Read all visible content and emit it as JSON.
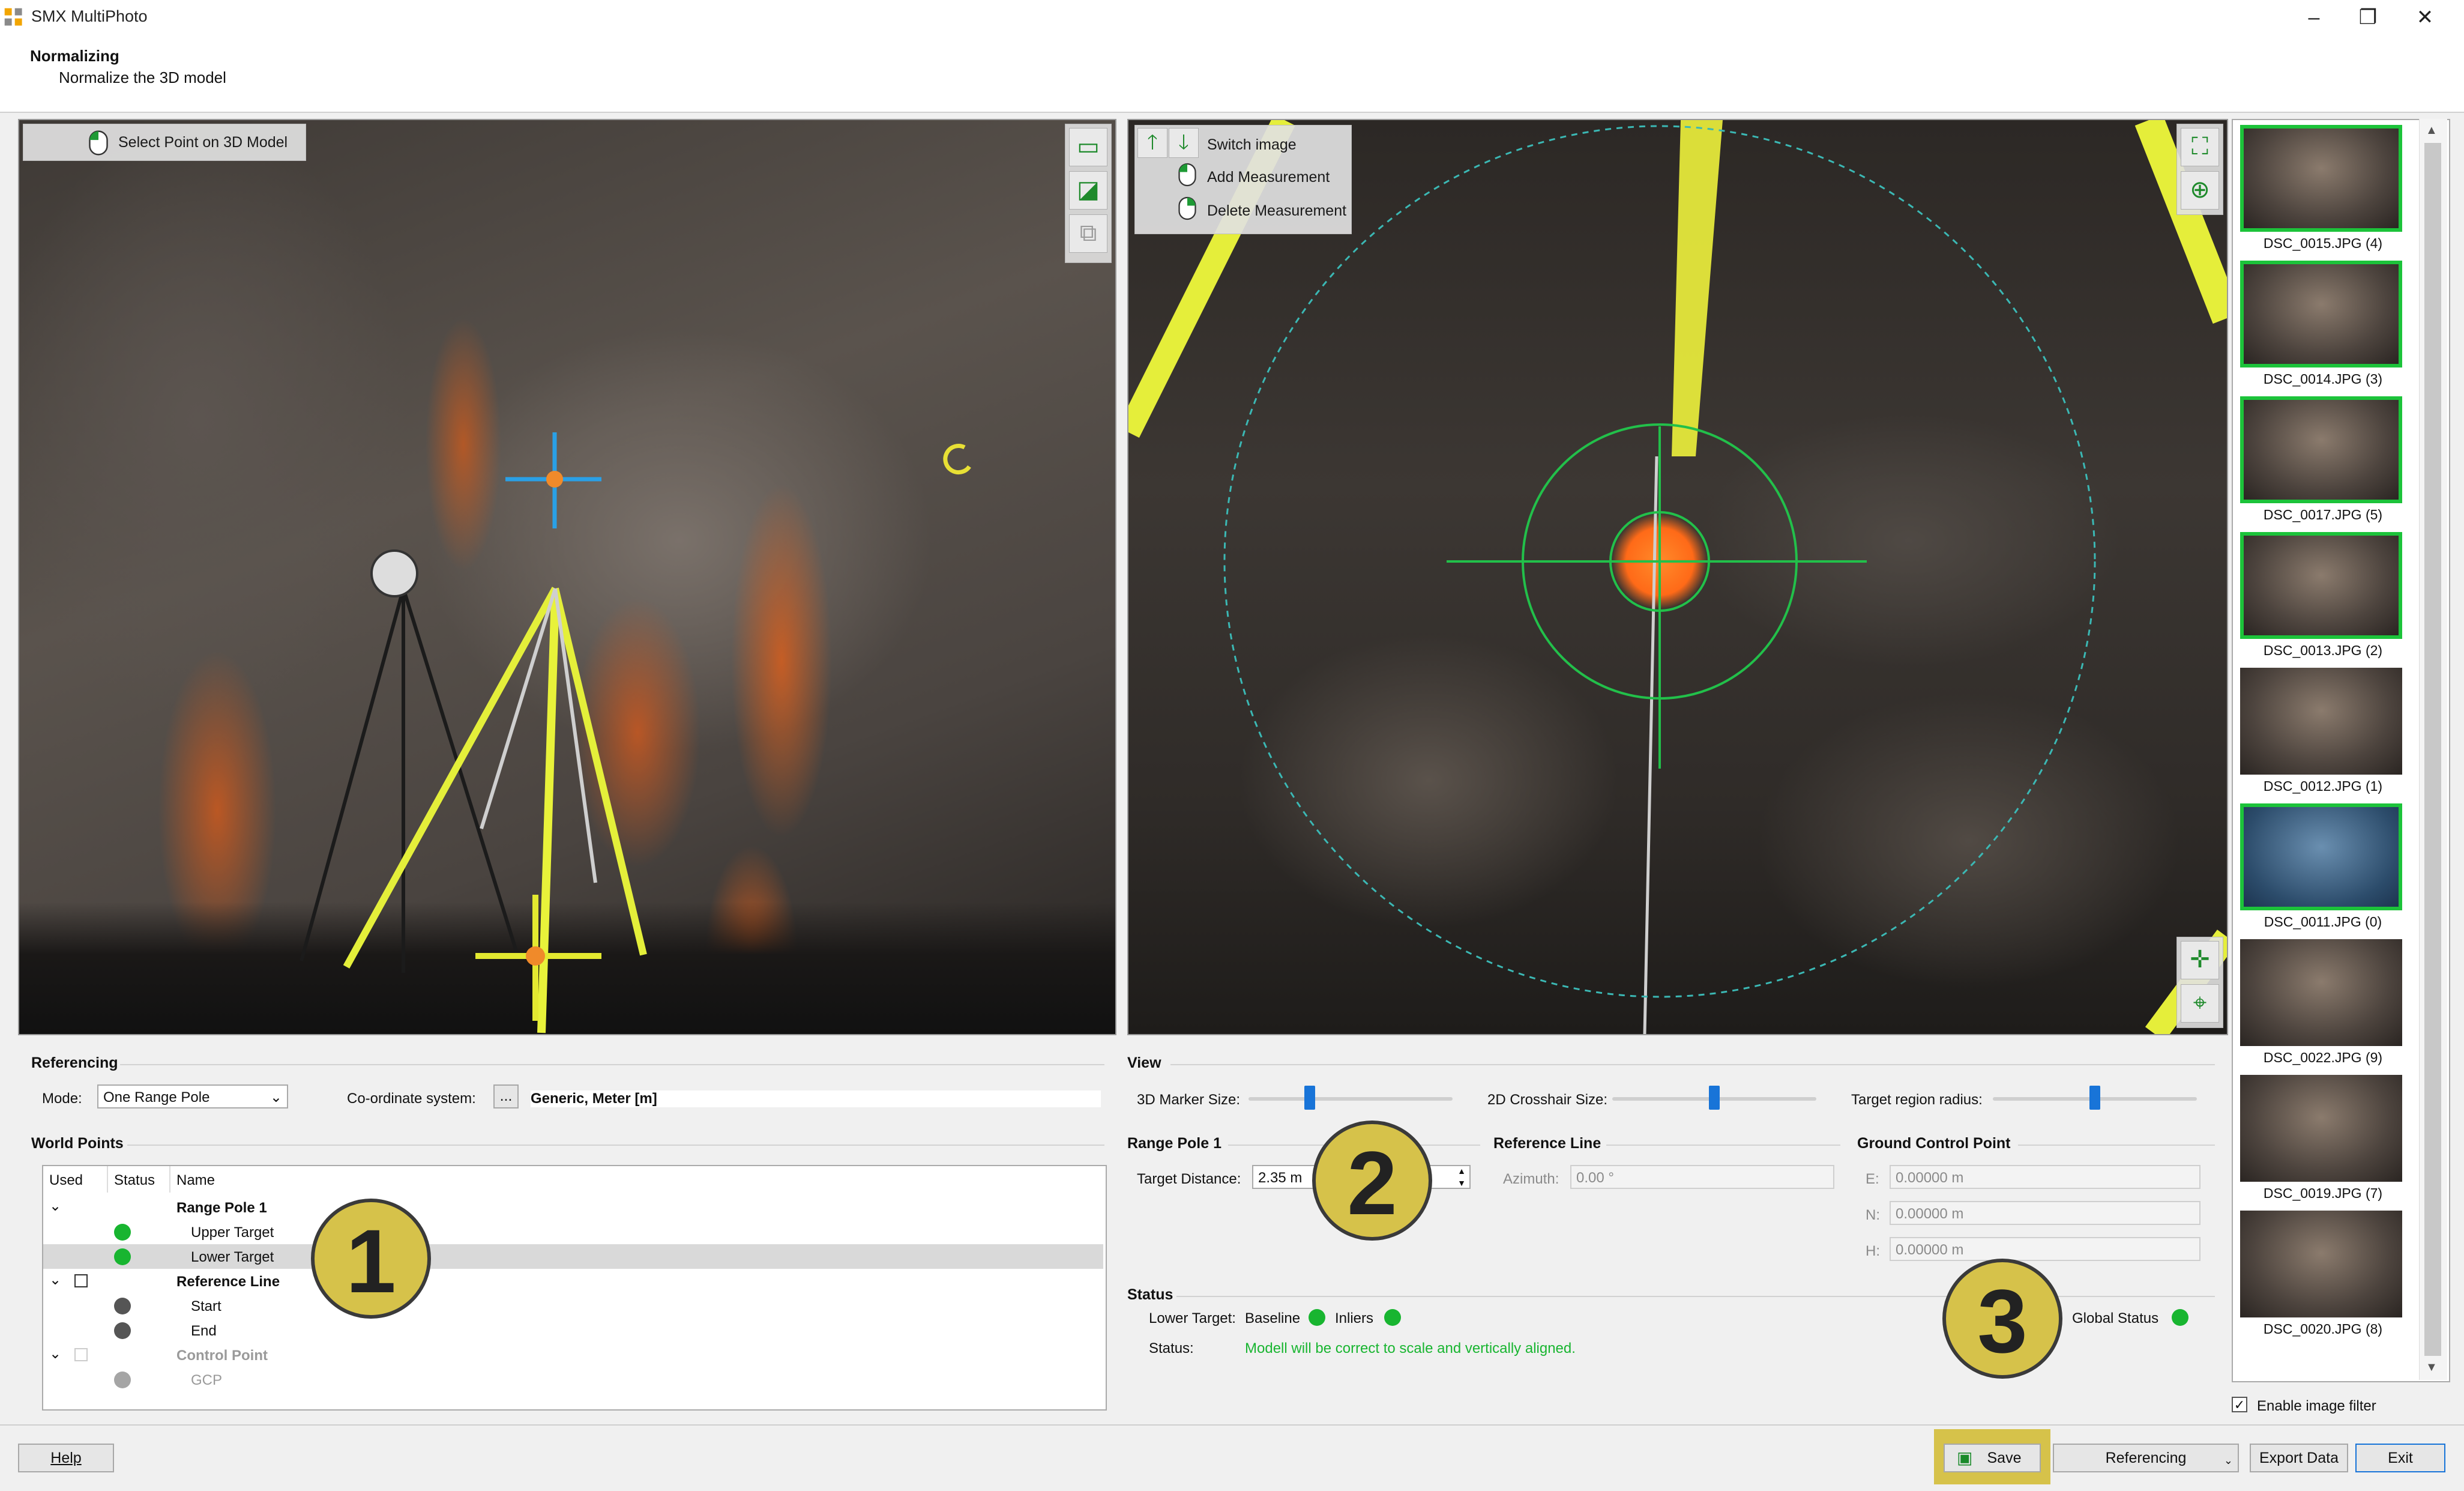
{
  "window": {
    "title": "SMX MultiPhoto",
    "minimize": "–",
    "restore": "❐",
    "close": "✕"
  },
  "header": {
    "title": "Normalizing",
    "subtitle": "Normalize the 3D model"
  },
  "view3d": {
    "select_point_label": "Select Point on 3D Model"
  },
  "view2d": {
    "switch_image": "Switch image",
    "add_measurement": "Add Measurement",
    "delete_measurement": "Delete Measurement"
  },
  "referencing": {
    "title": "Referencing",
    "mode_label": "Mode:",
    "mode_value": "One Range Pole",
    "coord_label": "Co-ordinate system:",
    "coord_button": "...",
    "coord_value": "Generic, Meter [m]"
  },
  "view": {
    "title": "View",
    "marker_size_label": "3D Marker Size:",
    "marker_size_level": 0.3,
    "crosshair_size_label": "2D Crosshair Size:",
    "crosshair_size_level": 0.5,
    "target_radius_label": "Target region radius:",
    "target_radius_level": 0.5
  },
  "world_points": {
    "title": "World Points",
    "columns": [
      "Used",
      "Status",
      "Name"
    ],
    "rows": [
      {
        "name": "Range Pole 1",
        "bold": true
      },
      {
        "name": "Upper Target",
        "status": "green"
      },
      {
        "name": "Lower Target",
        "status": "green",
        "selected": true
      },
      {
        "name": "Reference Line",
        "bold": true
      },
      {
        "name": "Start",
        "status": "dark"
      },
      {
        "name": "End",
        "status": "dark"
      },
      {
        "name": "Control Point",
        "bold": true,
        "disabled": true
      },
      {
        "name": "GCP",
        "status": "gray",
        "disabled": true
      }
    ]
  },
  "range_pole": {
    "title": "Range Pole 1",
    "target_distance_label": "Target Distance:",
    "target_distance_value": "2.35 m"
  },
  "reference_line": {
    "title": "Reference Line",
    "azimuth_label": "Azimuth:",
    "azimuth_value": "0.00 °"
  },
  "gcp": {
    "title": "Ground Control Point",
    "e_label": "E:",
    "e_value": "0.00000 m",
    "n_label": "N:",
    "n_value": "0.00000 m",
    "h_label": "H:",
    "h_value": "0.00000 m"
  },
  "status": {
    "title": "Status",
    "lower_target_label": "Lower Target:",
    "baseline_label": "Baseline",
    "inliers_label": "Inliers",
    "global_status_label": "Global Status",
    "status_label": "Status:",
    "status_message": "Modell will be correct to scale and vertically aligned.",
    "status_color": "#18b530"
  },
  "thumbnails": [
    {
      "label": "DSC_0015.JPG (4)",
      "selected": true
    },
    {
      "label": "DSC_0014.JPG (3)",
      "selected": true
    },
    {
      "label": "DSC_0017.JPG (5)",
      "selected": true
    },
    {
      "label": "DSC_0013.JPG (2)",
      "selected": true
    },
    {
      "label": "DSC_0012.JPG (1)",
      "selected": false
    },
    {
      "label": "DSC_0011.JPG (0)",
      "selected": true,
      "active": true
    },
    {
      "label": "DSC_0022.JPG (9)",
      "selected": false
    },
    {
      "label": "DSC_0019.JPG (7)",
      "selected": false
    },
    {
      "label": "DSC_0020.JPG (8)",
      "selected": false
    }
  ],
  "enable_filter": {
    "label": "Enable image filter",
    "checked": true
  },
  "buttons": {
    "help": "Help",
    "save": "Save",
    "referencing": "Referencing",
    "export": "Export Data",
    "exit": "Exit"
  },
  "badges": [
    "1",
    "2",
    "3"
  ],
  "colors": {
    "accent": "#1874d8",
    "select_green": "#1cc33a",
    "badge": "#d6c24a"
  }
}
